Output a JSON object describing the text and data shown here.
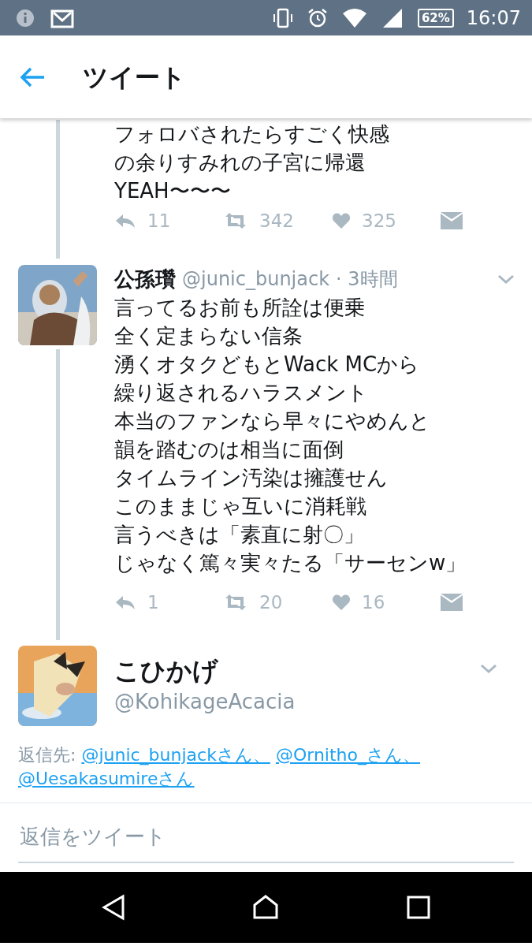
{
  "status_bar": {
    "battery": "62%",
    "time": "16:07"
  },
  "header": {
    "title": "ツイート"
  },
  "tweets": [
    {
      "kind": "continuation",
      "lines": [
        "フォロバされたらすごく快感",
        "の余りすみれの子宮に帰還",
        "YEAH〜〜〜"
      ],
      "replies": "11",
      "retweets": "342",
      "likes": "325"
    },
    {
      "kind": "reply",
      "name": "公孫瓚",
      "handle": "@junic_bunjack",
      "time": "· 3時間",
      "lines": [
        "言ってるお前も所詮は便乗",
        "全く定まらない信条",
        "湧くオタクどもとWack MCから",
        "繰り返されるハラスメント",
        "本当のファンなら早々にやめんと",
        "韻を踏むのは相当に面倒",
        "タイムライン汚染は擁護せん",
        "このままじゃ互いに消耗戦",
        "言うべきは「素直に射〇」",
        "じゃなく篤々実々たる「サーセンw」"
      ],
      "replies": "1",
      "retweets": "20",
      "likes": "16"
    },
    {
      "kind": "focused",
      "name": "こひかげ",
      "handle": "@KohikageAcacia",
      "reply_to_label": "返信先:",
      "reply_to": [
        "@junic_bunjackさん、",
        "@Ornitho_さん、",
        "@Uesakasumireさん"
      ]
    }
  ],
  "reply_box": {
    "placeholder": "返信をツイート"
  }
}
